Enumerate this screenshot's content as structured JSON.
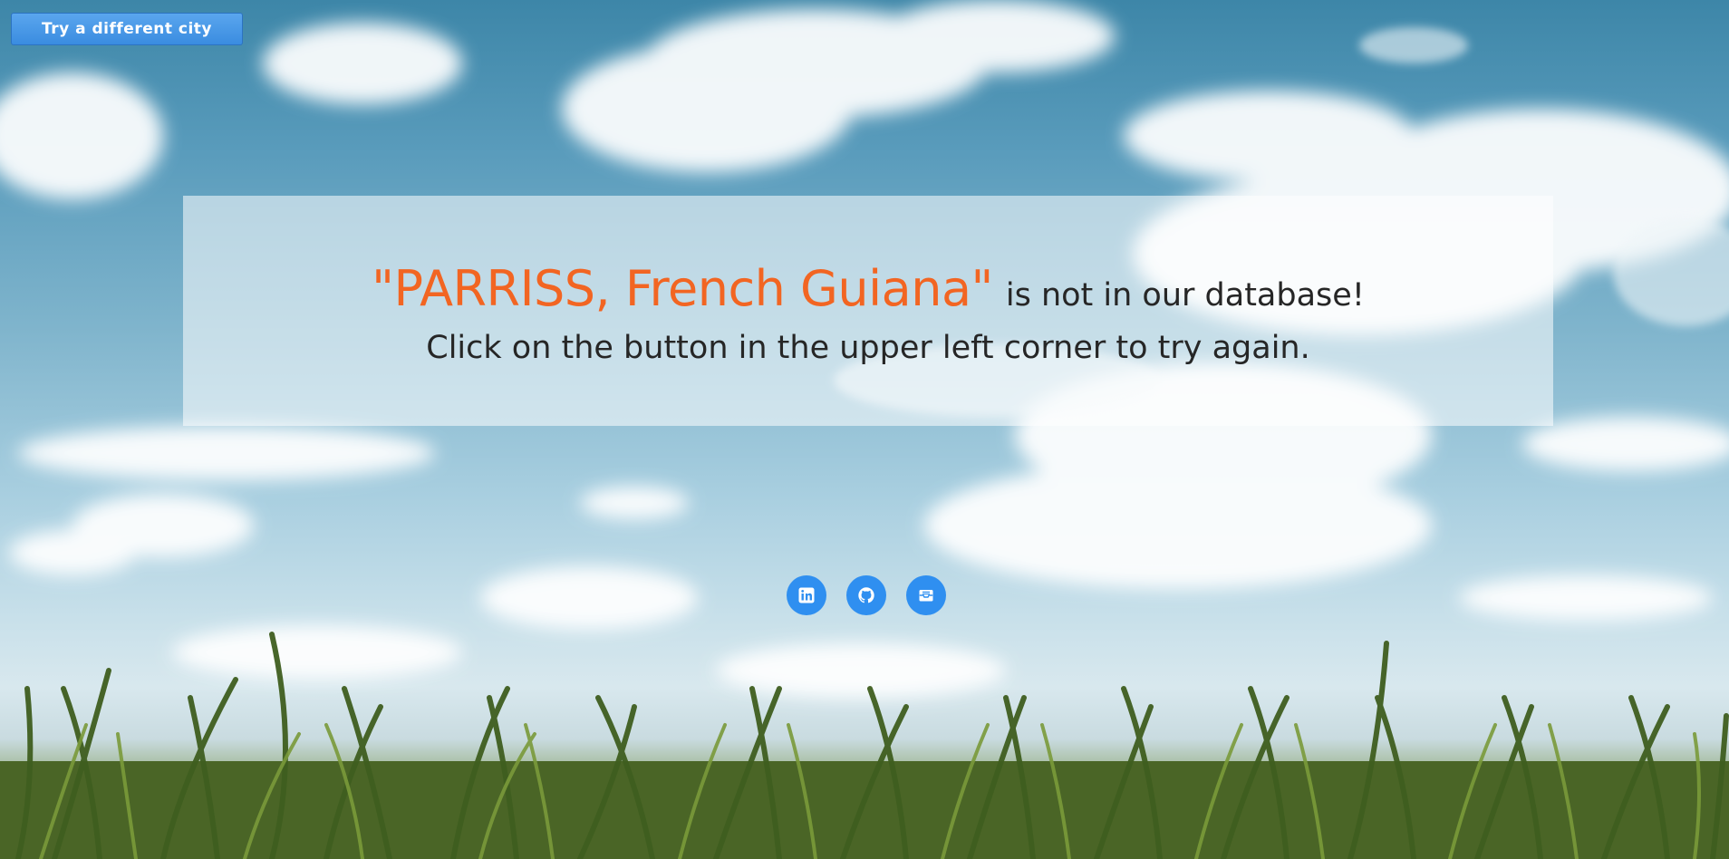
{
  "header": {
    "try_button_label": "Try a different city"
  },
  "message": {
    "city_quoted": "\"PARRISS, French Guiana\"",
    "not_in_db_text": "is not in our database!",
    "instruction_text": "Click on the button in the upper left corner to try again."
  },
  "social": {
    "items": [
      {
        "icon": "linkedin-icon"
      },
      {
        "icon": "github-icon"
      },
      {
        "icon": "email-icon"
      }
    ]
  },
  "colors": {
    "accent_orange": "#f26522",
    "button_blue": "#3a8ce0",
    "social_blue": "#2f8ff0",
    "text_dark": "#262626"
  }
}
